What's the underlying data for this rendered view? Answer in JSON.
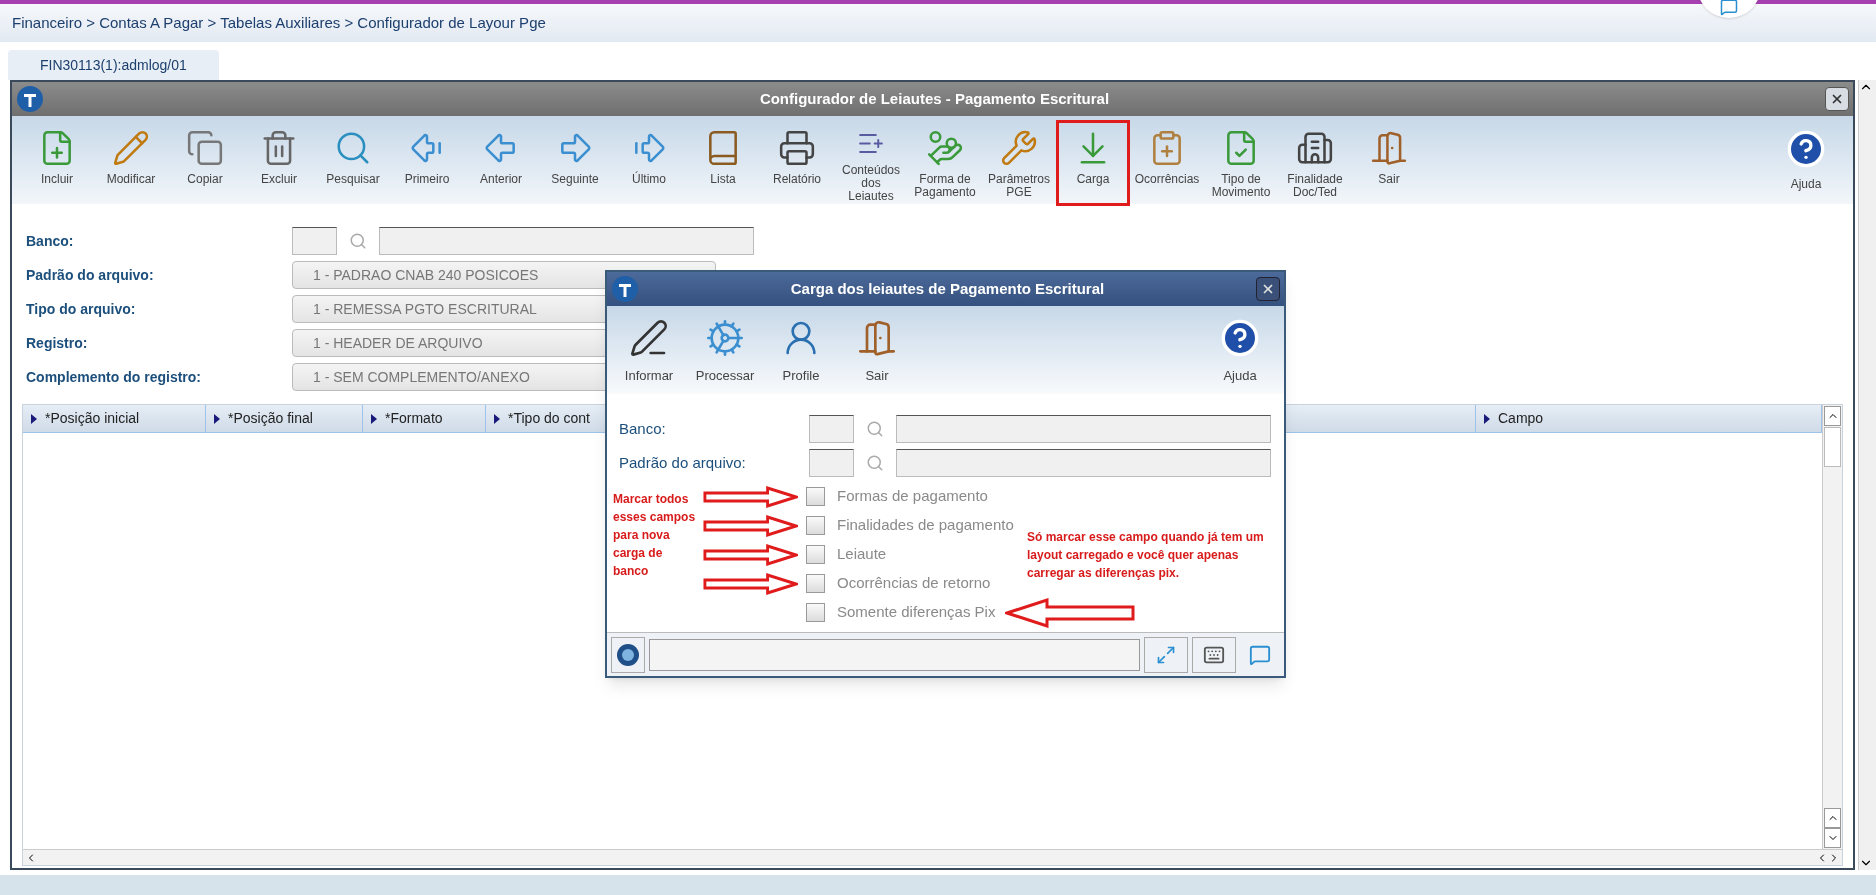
{
  "breadcrumb": "Financeiro > Contas A Pagar > Tabelas Auxiliares > Configurador de Layour Pge",
  "tabs": [
    {
      "label": "FIN30113(1):admlog/01",
      "selected": true
    }
  ],
  "window": {
    "title": "Configurador de Leiautes - Pagamento Escritural",
    "toolbar": [
      {
        "label": "Incluir",
        "highlighted": false
      },
      {
        "label": "Modificar",
        "highlighted": false
      },
      {
        "label": "Copiar",
        "highlighted": false
      },
      {
        "label": "Excluir",
        "highlighted": false
      },
      {
        "label": "Pesquisar",
        "highlighted": false
      },
      {
        "label": "Primeiro",
        "highlighted": false
      },
      {
        "label": "Anterior",
        "highlighted": false
      },
      {
        "label": "Seguinte",
        "highlighted": false
      },
      {
        "label": "Último",
        "highlighted": false
      },
      {
        "label": "Lista",
        "highlighted": false
      },
      {
        "label": "Relatório",
        "highlighted": false
      },
      {
        "label": "Conteúdos\ndos Leiautes",
        "highlighted": false
      },
      {
        "label": "Forma de\nPagamento",
        "highlighted": false
      },
      {
        "label": "Parâmetros\nPGE",
        "highlighted": false
      },
      {
        "label": "Carga",
        "highlighted": true
      },
      {
        "label": "Ocorrências",
        "highlighted": false
      },
      {
        "label": "Tipo de\nMovimento",
        "highlighted": false
      },
      {
        "label": "Finalidade\nDoc/Ted",
        "highlighted": false
      },
      {
        "label": "Sair",
        "highlighted": false
      }
    ],
    "help": "Ajuda",
    "form": [
      {
        "kind": "lookup",
        "label": "Banco:"
      },
      {
        "kind": "select",
        "label": "Padrão do arquivo:",
        "value": "1 - PADRAO CNAB 240 POSICOES"
      },
      {
        "kind": "select",
        "label": "Tipo do arquivo:",
        "value": "1 - REMESSA PGTO ESCRITURAL"
      },
      {
        "kind": "select",
        "label": "Registro:",
        "value": "1 - HEADER DE ARQUIVO"
      },
      {
        "kind": "select",
        "label": "Complemento do registro:",
        "value": "1 - SEM COMPLEMENTO/ANEXO"
      }
    ],
    "table": {
      "columns": [
        "*Posição inicial",
        "*Posição final",
        "*Formato",
        "*Tipo do  cont",
        "Campo"
      ]
    }
  },
  "dialog": {
    "title": "Carga dos leiautes de Pagamento Escritural",
    "toolbar": [
      "Informar",
      "Processar",
      "Profile",
      "Sair"
    ],
    "help": "Ajuda",
    "fields": [
      {
        "label": "Banco:"
      },
      {
        "label": "Padrão do arquivo:"
      }
    ],
    "options": [
      {
        "kind": "bulk",
        "label": "Formas de pagamento",
        "checked": false
      },
      {
        "kind": "bulk",
        "label": "Finalidades de pagamento",
        "checked": false
      },
      {
        "kind": "bulk",
        "label": "Leiaute",
        "checked": false
      },
      {
        "kind": "bulk",
        "label": "Ocorrências de retorno",
        "checked": false
      },
      {
        "kind": "pix",
        "label": "Somente diferenças Pix",
        "checked": false
      }
    ],
    "notes": [
      "Marcar todos esses campos para nova carga de banco",
      "Só marcar esse campo quando já tem um layout carregado e você quer apenas carregar as diferenças pix."
    ]
  }
}
